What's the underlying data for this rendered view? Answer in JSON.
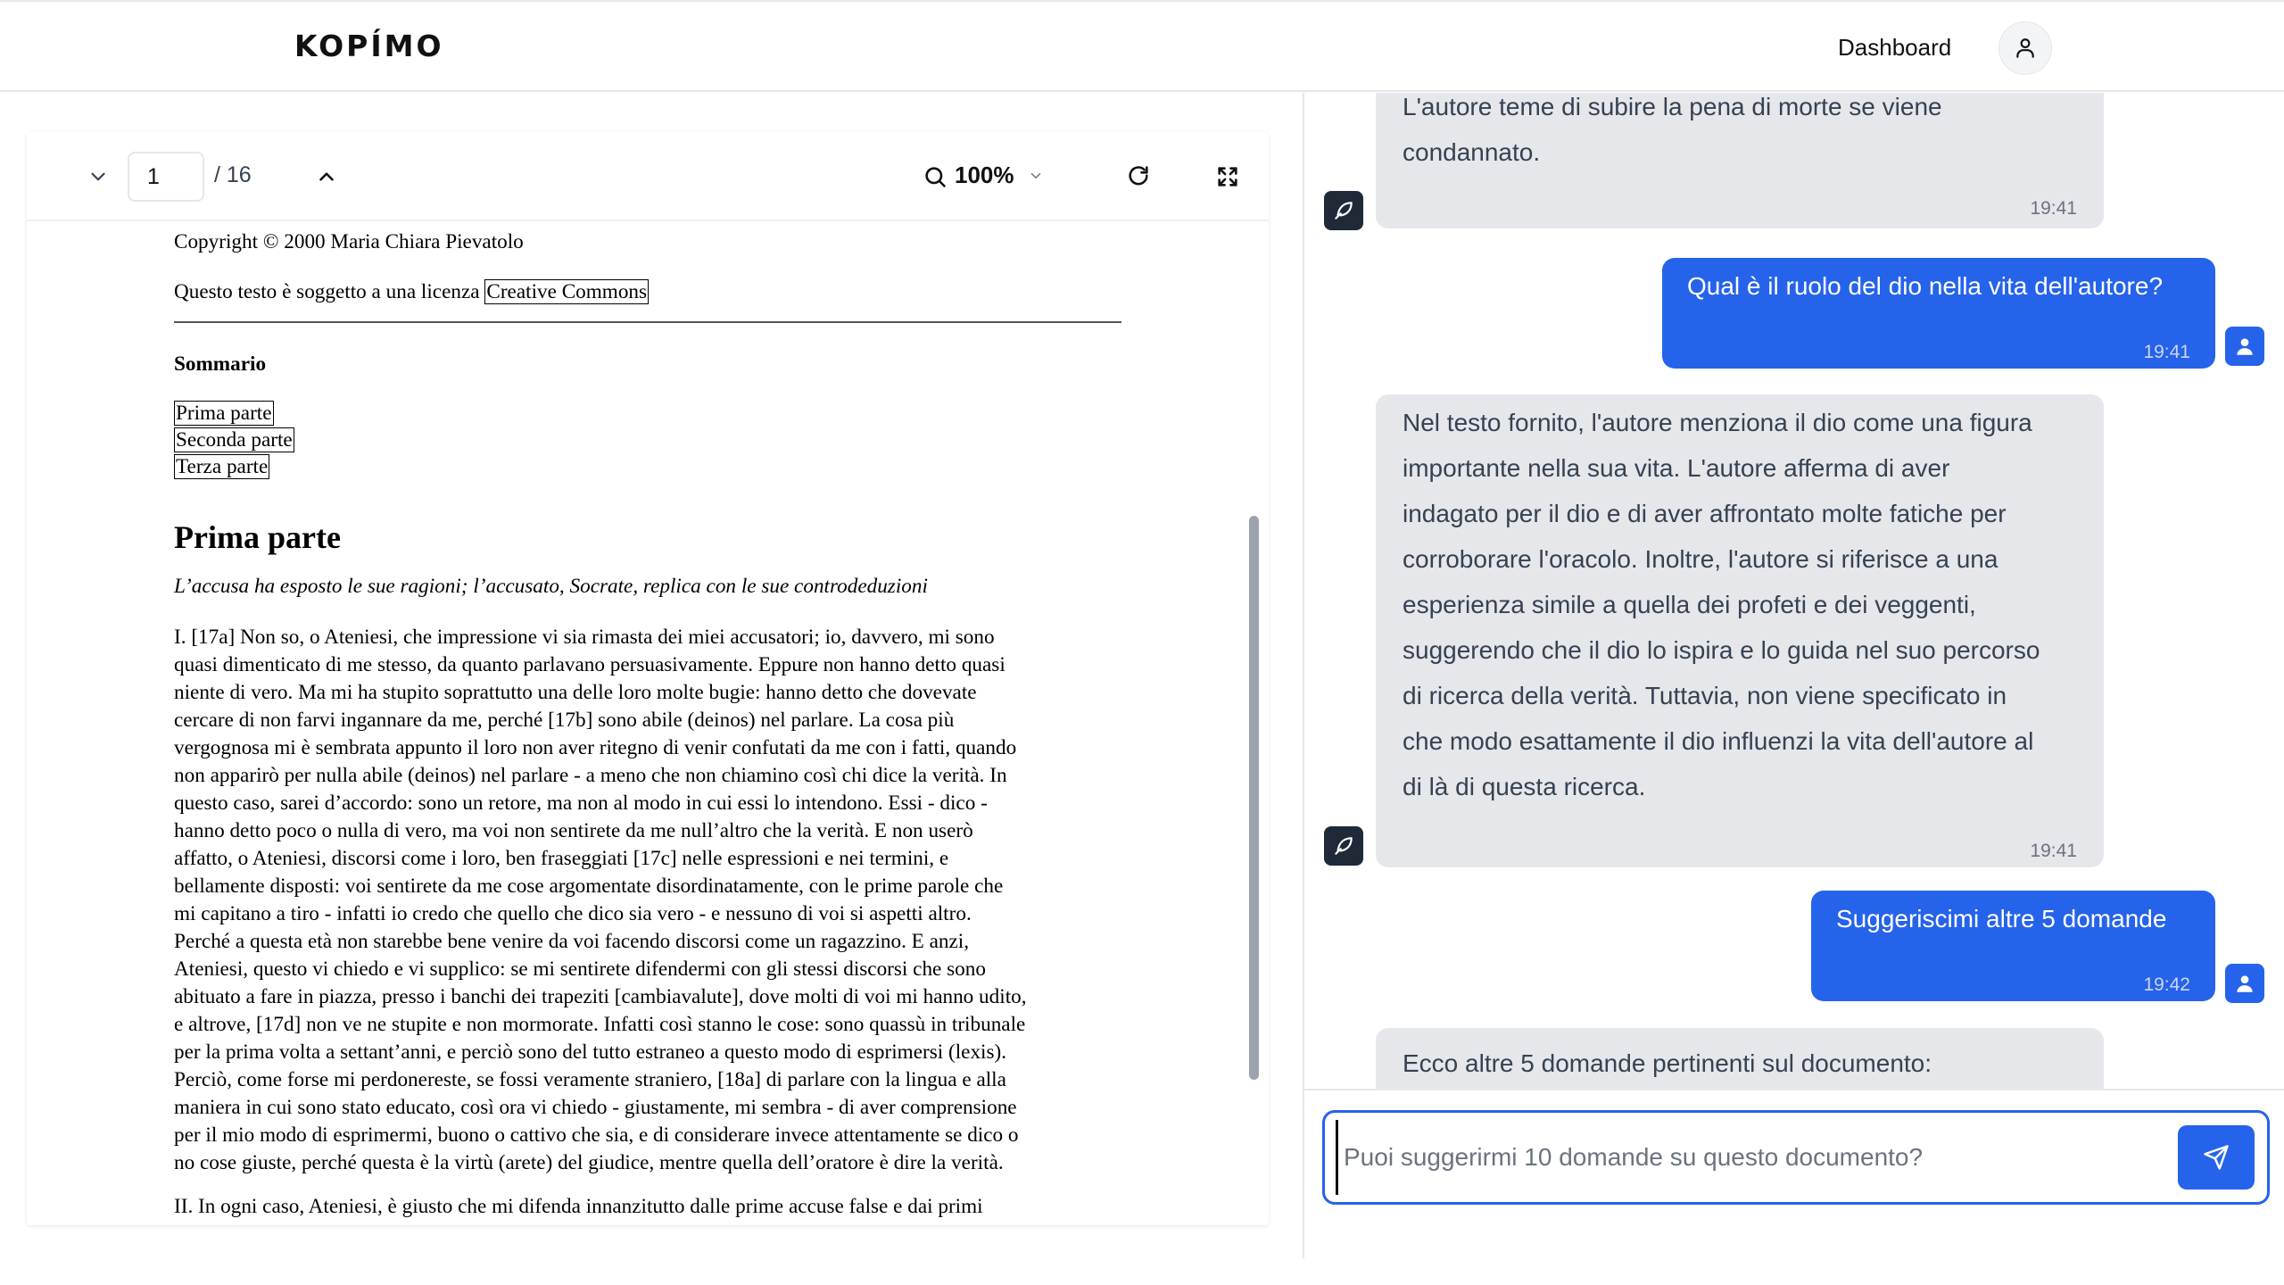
{
  "header": {
    "logo": "KOPÍMO",
    "nav_dashboard": "Dashboard"
  },
  "viewer": {
    "page_current": "1",
    "page_total": "/ 16",
    "zoom": "100%",
    "doc": {
      "copyright": "Copyright © 2000 Maria Chiara Pievatolo",
      "license_prefix": "Questo testo è soggetto a una licenza",
      "license_link": "Creative Commons",
      "sommario_title": "Sommario",
      "toc": [
        "Prima parte",
        "Seconda parte",
        "Terza parte"
      ],
      "heading": "Prima parte",
      "subtitle": "L’accusa ha esposto le sue ragioni; l’accusato, Socrate, replica con le sue controdeduzioni",
      "para1_lines": [
        "I. [17a] Non so, o Ateniesi, che impressione vi sia rimasta dei miei accusatori; io, davvero, mi sono",
        "quasi dimenticato di me stesso, da quanto parlavano persuasivamente. Eppure non hanno detto quasi",
        "niente di vero. Ma mi ha stupito soprattutto una delle loro molte bugie: hanno detto che dovevate",
        "cercare di non farvi ingannare da me, perché [17b] sono abile (deinos) nel parlare. La cosa più",
        "vergognosa mi è sembrata appunto il loro non aver ritegno di venir confutati da me con i fatti, quando",
        "non apparirò per nulla abile (deinos) nel parlare - a meno che non chiamino così chi dice la verità. In",
        "questo caso, sarei d’accordo: sono un retore, ma non al modo in cui essi lo intendono. Essi - dico -",
        "hanno detto poco o nulla di vero, ma voi non sentirete da me null’altro che la verità. E non userò",
        "affatto, o Ateniesi, discorsi come i loro, ben fraseggiati [17c] nelle espressioni e nei termini, e",
        "bellamente disposti: voi sentirete da me cose argomentate disordinatamente, con le prime parole che",
        "mi capitano a tiro - infatti io credo che quello che dico sia vero - e nessuno di voi si aspetti altro.",
        "Perché a questa età non starebbe bene venire da voi facendo discorsi come un ragazzino. E anzi,",
        "Ateniesi, questo vi chiedo e vi supplico: se mi sentirete difendermi con gli stessi discorsi che sono",
        "abituato a fare in piazza, presso i banchi dei trapeziti [cambiavalute], dove molti di voi mi hanno udito,",
        "e altrove, [17d] non ve ne stupite e non mormorate. Infatti così stanno le cose: sono quassù in tribunale",
        "per la prima volta a settant’anni, e perciò sono del tutto estraneo a questo modo di esprimersi (lexis).",
        "Perciò, come forse mi perdonereste, se fossi veramente straniero, [18a] di parlare con la lingua e alla",
        "maniera in cui sono stato educato, così ora vi chiedo - giustamente, mi sembra - di aver comprensione",
        "per il mio modo di esprimermi, buono o cattivo che sia, e di considerare invece attentamente se dico o",
        "no cose giuste, perché questa è la virtù (arete) del giudice, mentre quella dell’oratore è dire la verità."
      ],
      "para2_lines": [
        "II. In ogni caso, Ateniesi, è giusto che mi difenda innanzitutto dalle prime accuse false e dai primi"
      ]
    }
  },
  "chat": {
    "messages": [
      {
        "role": "ai",
        "lines": [
          "L'autore teme di subire la pena di morte se viene",
          "condannato."
        ],
        "time": "19:41"
      },
      {
        "role": "user",
        "text": "Qual è il ruolo del dio nella vita dell'autore?",
        "time": "19:41"
      },
      {
        "role": "ai",
        "lines": [
          "Nel testo fornito, l'autore menziona il dio come una figura",
          "importante nella sua vita. L'autore afferma di aver",
          "indagato per il dio e di aver affrontato molte fatiche per",
          "corroborare l'oracolo. Inoltre, l'autore si riferisce a una",
          "esperienza simile a quella dei profeti e dei veggenti,",
          "suggerendo che il dio lo ispira e lo guida nel suo percorso",
          "di ricerca della verità. Tuttavia, non viene specificato in",
          "che modo esattamente il dio influenzi la vita dell'autore al",
          "di là di questa ricerca."
        ],
        "time": "19:41"
      },
      {
        "role": "user",
        "text": "Suggeriscimi altre 5 domande",
        "time": "19:42"
      },
      {
        "role": "ai",
        "lines": [
          "Ecco altre 5 domande pertinenti sul documento:"
        ],
        "time": ""
      }
    ],
    "input_placeholder": "Puoi suggerirmi 10 domande su questo documento?"
  },
  "colors": {
    "accent": "#2563eb",
    "ai_bubble": "#e5e7eb",
    "bot_icon_bg": "#1f2937"
  },
  "icons": {
    "prev_page": "chevron-down-icon",
    "next_page": "chevron-up-icon",
    "zoom": "search-icon",
    "zoom_menu": "chevron-down-icon",
    "rotate": "refresh-icon",
    "fullscreen": "expand-icon",
    "profile": "user-icon",
    "bot": "feather-icon",
    "send": "send-icon"
  }
}
